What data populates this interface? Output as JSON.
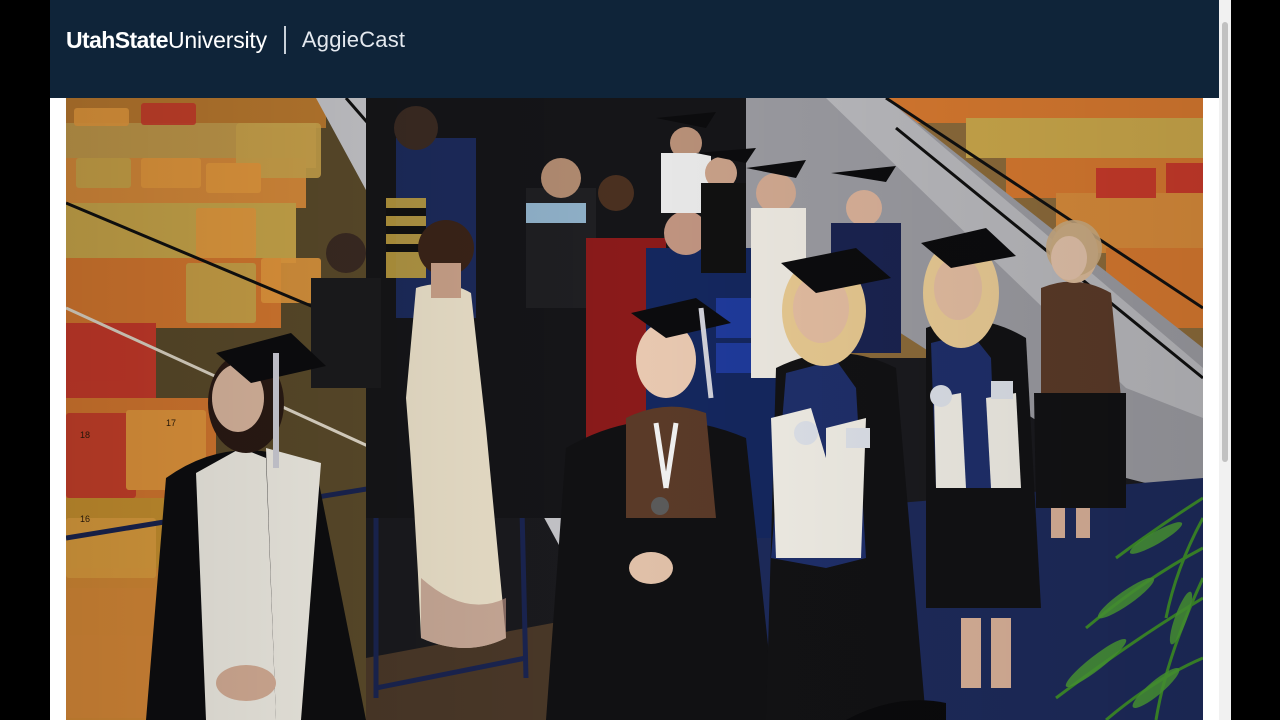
{
  "header": {
    "brand_bold": "UtahState",
    "brand_light": "University",
    "product": "AggieCast"
  },
  "video": {
    "scene": "commencement-procession",
    "seat_numbers": [
      "18",
      "17",
      "16"
    ]
  },
  "colors": {
    "header_bg": "#0f2439",
    "page_bg": "#ffffff",
    "letterbox": "#000000",
    "usu_navy": "#0f2439",
    "stole_white": "#f2efe6",
    "gown_black": "#111111",
    "seat_orange": "#d5782f",
    "seat_yellow": "#c9a64a",
    "carpet_navy": "#1d2a5a"
  },
  "icons": [
    "usu-logo",
    "scroll-thumb"
  ]
}
